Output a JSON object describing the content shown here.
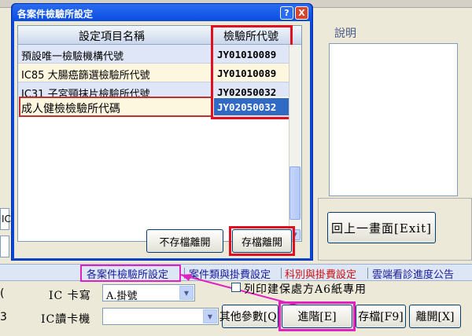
{
  "background": {
    "description_label": "說明",
    "return_button": "回上一畫面[Exit]",
    "left_field_fragment": "IC"
  },
  "tabs": [
    {
      "label": "各案件檢驗所設定",
      "color": "#1a1aa0"
    },
    {
      "label": "案件類與掛費設定",
      "color": "#1a1aa0"
    },
    {
      "label": "科別與掛費設定",
      "color": "#d01010"
    },
    {
      "label": "雲端看診進度公告",
      "color": "#1a1aa0"
    }
  ],
  "form": {
    "ic_write_label": "IC 卡寫",
    "ic_write_value": "A.掛號",
    "ic_reader_label": "IC讀卡機",
    "ic_reader_value": "",
    "print_checkbox_label": "列印建保處方A6紙專用",
    "print_checked": false,
    "left_edge_fragment": "(",
    "left_edge_fragment2": "3"
  },
  "bottom_buttons": {
    "other_params": "其他參數[Q]",
    "advanced": "進階[E]",
    "save": "存檔[F9]",
    "exit": "離開[X]"
  },
  "dialog": {
    "title": "各案件檢驗所設定",
    "help_btn": "?",
    "close_btn": "X",
    "columns": {
      "name": "設定項目名稱",
      "code": "檢驗所代號"
    },
    "rows": [
      {
        "name": "預設唯一檢驗機構代號",
        "code": "JY01010089"
      },
      {
        "name": "IC85 大腸癌篩選檢驗所代號",
        "code": "JY01010089"
      },
      {
        "name": "IC31 子宮頸抹片檢驗所代號",
        "code": "JY02050032"
      },
      {
        "name": "成人健檢檢驗所代碼",
        "code": "JY02050032"
      }
    ],
    "no_save_exit": "不存檔離開",
    "save_exit": "存檔離開"
  },
  "colors": {
    "highlight_red": "#e01020",
    "selection_blue": "#316ac5",
    "tab_magenta": "#e020c0"
  }
}
